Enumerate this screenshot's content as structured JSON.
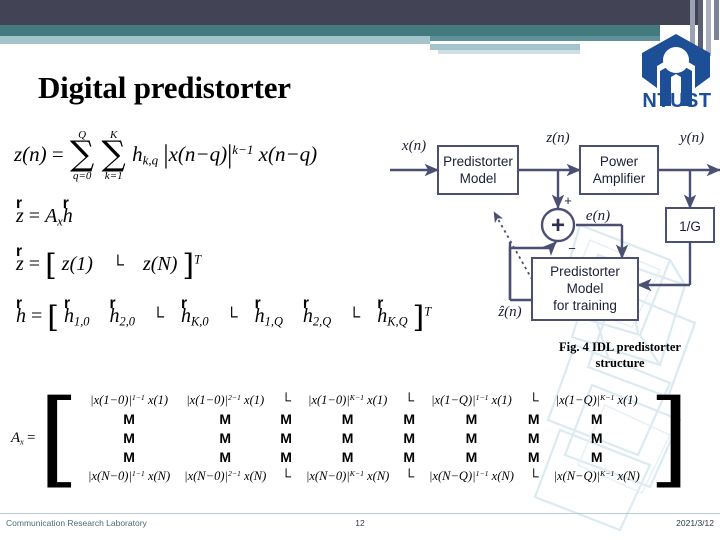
{
  "slide": {
    "title": "Digital predistorter",
    "logo_text": "NTUST",
    "figure_caption_line1": "Fig. 4 IDL predistorter",
    "figure_caption_line2": "structure"
  },
  "colors": {
    "band_dark": "#424456",
    "band_teal": "#427a80",
    "band_light": "#a4c4cd",
    "logo_blue": "#1c4f96",
    "diagram_stroke": "#4a4f73",
    "footer_text": "#4b6b78"
  },
  "equations": {
    "eq1": {
      "lhs": "z(n)",
      "eq": "=",
      "sum_outer": {
        "sigma": "∑",
        "upper": "Q",
        "lower": "q=0"
      },
      "sum_inner": {
        "sigma": "∑",
        "upper": "K",
        "lower": "k=1"
      },
      "coeff": "h",
      "coeff_sub": "k,q",
      "abs_expr": "x(n−q)",
      "abs_exp": "k−1",
      "tail": "x(n−q)"
    },
    "eq2": {
      "lhs_vec": "z",
      "eq": "=",
      "matrix_symbol": "A",
      "matrix_sub": "x",
      "rhs_vec": "h"
    },
    "eq3": {
      "lhs_vec": "z",
      "eq": "=",
      "open": "[",
      "first": "z(1)",
      "dots": "└",
      "last": "z(N)",
      "close": "]",
      "transpose": "T"
    },
    "eq4": {
      "lhs_vec": "h",
      "eq": "=",
      "open": "[",
      "close": "]",
      "transpose": "T",
      "dots": "└",
      "items": [
        {
          "sym": "h",
          "sub": "1,0"
        },
        {
          "sym": "h",
          "sub": "2,0"
        },
        {
          "sym": "h",
          "sub": "K,0"
        },
        {
          "sym": "h",
          "sub": "1,Q"
        },
        {
          "sym": "h",
          "sub": "2,Q"
        },
        {
          "sym": "h",
          "sub": "K,Q"
        }
      ]
    },
    "eq5": {
      "lhs": "A",
      "lhs_sub": "x",
      "eq": "=",
      "open": "[",
      "close": "]",
      "vdots": "M",
      "hdots": "└",
      "rows": [
        [
          {
            "type": "term",
            "abs": "x(1−0)",
            "exp": "1−1",
            "tail": "x(1)"
          },
          {
            "type": "term",
            "abs": "x(1−0)",
            "exp": "2−1",
            "tail": "x(1)"
          },
          {
            "type": "dots",
            "text": "└"
          },
          {
            "type": "term",
            "abs": "x(1−0)",
            "exp": "K−1",
            "tail": "x(1)"
          },
          {
            "type": "dots",
            "text": "└"
          },
          {
            "type": "term",
            "abs": "x(1−Q)",
            "exp": "1−1",
            "tail": "x(1)"
          },
          {
            "type": "dots",
            "text": "└"
          },
          {
            "type": "term",
            "abs": "x(1−Q)",
            "exp": "K−1",
            "tail": "x(1)"
          }
        ],
        [
          {
            "type": "vdots",
            "text": "M"
          },
          {
            "type": "vdots",
            "text": "M"
          },
          {
            "type": "vdots",
            "text": "M"
          },
          {
            "type": "vdots",
            "text": "M"
          },
          {
            "type": "vdots",
            "text": "M"
          },
          {
            "type": "vdots",
            "text": "M"
          },
          {
            "type": "vdots",
            "text": "M"
          },
          {
            "type": "vdots",
            "text": "M"
          }
        ],
        [
          {
            "type": "vdots",
            "text": "M"
          },
          {
            "type": "vdots",
            "text": "M"
          },
          {
            "type": "vdots",
            "text": "M"
          },
          {
            "type": "vdots",
            "text": "M"
          },
          {
            "type": "vdots",
            "text": "M"
          },
          {
            "type": "vdots",
            "text": "M"
          },
          {
            "type": "vdots",
            "text": "M"
          },
          {
            "type": "vdots",
            "text": "M"
          }
        ],
        [
          {
            "type": "vdots",
            "text": "M"
          },
          {
            "type": "vdots",
            "text": "M"
          },
          {
            "type": "vdots",
            "text": "M"
          },
          {
            "type": "vdots",
            "text": "M"
          },
          {
            "type": "vdots",
            "text": "M"
          },
          {
            "type": "vdots",
            "text": "M"
          },
          {
            "type": "vdots",
            "text": "M"
          },
          {
            "type": "vdots",
            "text": "M"
          }
        ],
        [
          {
            "type": "term",
            "abs": "x(N−0)",
            "exp": "1−1",
            "tail": "x(N)"
          },
          {
            "type": "term",
            "abs": "x(N−0)",
            "exp": "2−1",
            "tail": "x(N)"
          },
          {
            "type": "dots",
            "text": "└"
          },
          {
            "type": "term",
            "abs": "x(N−0)",
            "exp": "K−1",
            "tail": "x(N)"
          },
          {
            "type": "dots",
            "text": "└"
          },
          {
            "type": "term",
            "abs": "x(N−Q)",
            "exp": "1−1",
            "tail": "x(N)"
          },
          {
            "type": "dots",
            "text": "└"
          },
          {
            "type": "term",
            "abs": "x(N−Q)",
            "exp": "K−1",
            "tail": "x(N)"
          }
        ]
      ]
    }
  },
  "diagram": {
    "blocks": [
      {
        "id": "predistorter-model",
        "line1": "Predistorter",
        "line2": "Model"
      },
      {
        "id": "power-amplifier",
        "line1": "Power",
        "line2": "Amplifier"
      },
      {
        "id": "gain-inverse",
        "line1": "1/G"
      },
      {
        "id": "predistorter-model-training",
        "line1": "Predistorter",
        "line2": "Model",
        "line3": "for training"
      }
    ],
    "signals": {
      "input": "x(n)",
      "predistorted": "z(n)",
      "output": "y(n)",
      "error": "e(n)",
      "estimate": "ẑ(n)"
    },
    "adder": {
      "symbol": "+",
      "plus_label": "+",
      "minus_label": "−"
    }
  },
  "footer": {
    "left": "Communication Research Laboratory",
    "page": "12",
    "date": "2021/3/12"
  }
}
